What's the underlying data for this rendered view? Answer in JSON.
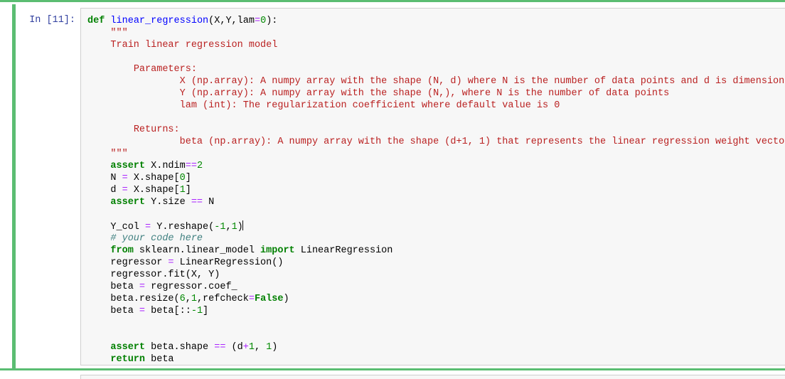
{
  "notebook": {
    "accent_color": "#5bbd72",
    "cell_background": "#f7f7f7",
    "prompt_color": "#303f9f"
  },
  "cell": {
    "prompt_label": "In [11]:",
    "execution_count": "11",
    "cell_type": "code",
    "language": "python",
    "selected": true,
    "cursor_line": 19,
    "source_lines": [
      "def linear_regression(X,Y,lam=0):",
      "    \"\"\"",
      "    Train linear regression model",
      "",
      "        Parameters:",
      "                X (np.array): A numpy array with the shape (N, d) where N is the number of data points and d is dimension",
      "                Y (np.array): A numpy array with the shape (N,), where N is the number of data points",
      "                lam (int): The regularization coefficient where default value is 0",
      "",
      "        Returns:",
      "                beta (np.array): A numpy array with the shape (d+1, 1) that represents the linear regression weight vector",
      "    \"\"\"",
      "    assert X.ndim==2",
      "    N = X.shape[0]",
      "    d = X.shape[1]",
      "    assert Y.size == N",
      "",
      "    Y_col = Y.reshape(-1,1)",
      "    # your code here",
      "    from sklearn.linear_model import LinearRegression",
      "    regressor = LinearRegression()",
      "    regressor.fit(X, Y)",
      "    beta = regressor.coef_",
      "    beta.resize(6,1,refcheck=False)",
      "    beta = beta[::-1]",
      "",
      "",
      "    assert beta.shape == (d+1, 1)",
      "    return beta"
    ],
    "tokens": {
      "keywords": [
        "def",
        "assert",
        "from",
        "import",
        "return",
        "False"
      ],
      "function_name": "linear_regression",
      "comment": "# your code here",
      "numbers": [
        "0",
        "2",
        "0",
        "1",
        "1",
        "1",
        "6",
        "1",
        "1",
        "1",
        "1"
      ]
    }
  }
}
